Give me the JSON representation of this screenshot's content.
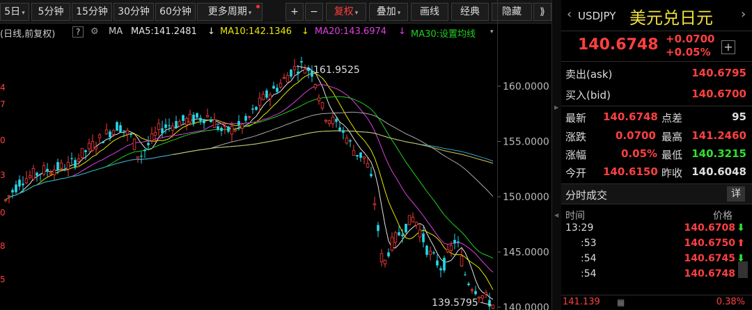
{
  "toolbar": {
    "period_day": "5日",
    "m5": "5分钟",
    "m15": "15分钟",
    "m30": "30分钟",
    "m60": "60分钟",
    "more": "更多周期",
    "plus": "+",
    "minus": "−",
    "restore": "复权",
    "overlay": "叠加",
    "draw": "画线",
    "classic": "经典",
    "hide": "隐藏",
    "expand": "⟫"
  },
  "indicator": {
    "prefix": "(日线,前复权)",
    "help": "?",
    "ma_label": "MA",
    "ma5": "MA5:141.2481",
    "ma10": "MA10:142.1346",
    "ma20": "MA20:143.6974",
    "ma30": "MA30:设置均线",
    "arrow": "↓"
  },
  "colors": {
    "up": "#ff3b3b",
    "down": "#25d8e8",
    "ma5": "#e6e6e6",
    "ma10": "#e8e800",
    "ma20": "#e040e0",
    "ma30": "#20d020",
    "ma60": "#aaaaaa",
    "ma120": "#2aa8c8",
    "ma250": "#d8c860"
  },
  "chart_data": {
    "type": "candlestick",
    "y_ticks": [
      "160.0000",
      "155.0000",
      "150.0000",
      "145.0000",
      "140.0000"
    ],
    "ylim": [
      139.5,
      162.5
    ],
    "annotations": {
      "high": "161.9525",
      "low": "139.5795"
    },
    "left_fragments": [
      "4",
      "7",
      "0",
      "3",
      "0",
      "8",
      "5"
    ]
  },
  "quote": {
    "symbol": "USDJPY",
    "name": "美元兑日元",
    "price": "140.6748",
    "change": "+0.0700",
    "change_pct": "+0.05%",
    "ask_label": "卖出(ask)",
    "ask": "140.6795",
    "bid_label": "买入(bid)",
    "bid": "140.6700",
    "latest_label": "最新",
    "latest": "140.6748",
    "spread_label": "点差",
    "spread": "95",
    "chg_label": "涨跌",
    "chg": "0.0700",
    "high_label": "最高",
    "high": "141.2460",
    "amp_label": "涨幅",
    "amp": "0.05%",
    "low_label": "最低",
    "low": "140.3215",
    "open_label": "今开",
    "open": "140.6150",
    "prev_label": "昨收",
    "prev": "140.6048"
  },
  "ticks": {
    "title": "分时成交",
    "detail": "详",
    "col_time": "时间",
    "col_price": "价格",
    "rows": [
      {
        "time": "13:29",
        "price": "140.6708",
        "dir": "⬇"
      },
      {
        "time": ":53",
        "price": "140.6750",
        "dir": "⬆"
      },
      {
        "time": ":54",
        "price": "140.6745",
        "dir": "⬇"
      },
      {
        "time": ":54",
        "price": "140.6748",
        "dir": "⬆"
      }
    ],
    "footer_left": "141.139",
    "footer_right": "0.38%"
  }
}
